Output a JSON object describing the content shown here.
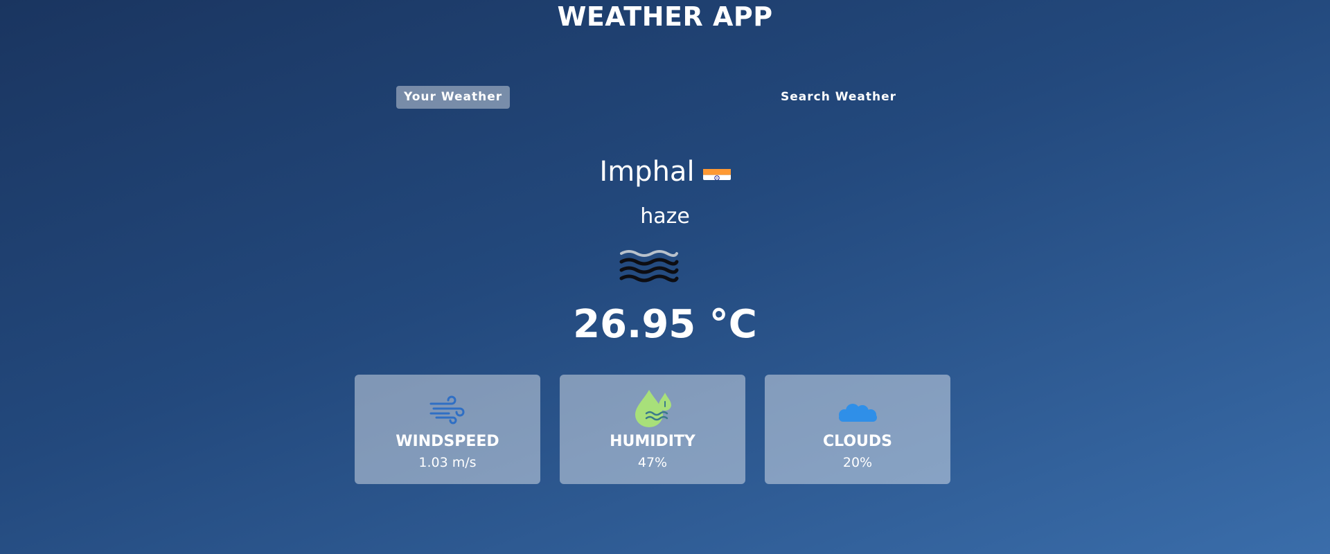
{
  "header": {
    "title": "WEATHER APP"
  },
  "tabs": [
    {
      "label": "Your Weather",
      "active": true
    },
    {
      "label": "Search Weather",
      "active": false
    }
  ],
  "weather": {
    "city": "Imphal",
    "country_flag_icon": "india-flag-icon",
    "condition": "haze",
    "condition_icon": "haze-icon",
    "temperature": "26.95 °C"
  },
  "stats": [
    {
      "icon": "wind-icon",
      "label": "WINDSPEED",
      "value": "1.03 m/s"
    },
    {
      "icon": "humidity-icon",
      "label": "HUMIDITY",
      "value": "47%"
    },
    {
      "icon": "cloud-icon",
      "label": "CLOUDS",
      "value": "20%"
    }
  ],
  "colors": {
    "background_start": "#1a3560",
    "background_end": "#3a6daa",
    "wind_icon": "#2f6fc4",
    "humidity_icon": "#a8e07a",
    "cloud_icon": "#2f8fe8"
  }
}
